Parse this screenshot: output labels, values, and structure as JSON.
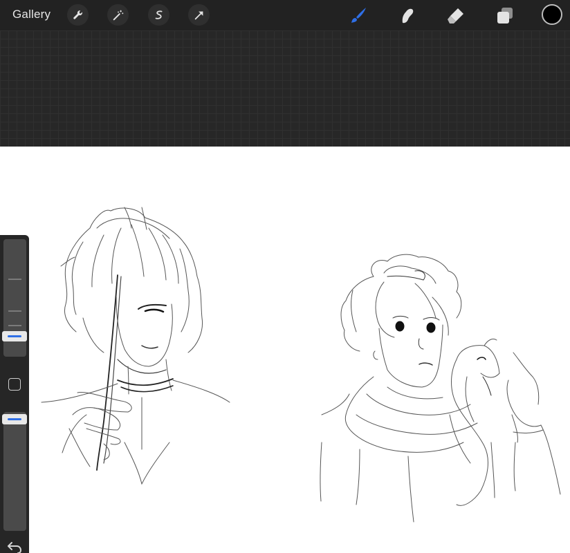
{
  "toolbar": {
    "gallery_label": "Gallery",
    "left_tools": [
      "wrench-icon",
      "magic-wand-icon",
      "selection-icon",
      "transform-arrow-icon"
    ],
    "right_tools": [
      "brush-icon",
      "smudge-icon",
      "eraser-icon",
      "layers-icon"
    ],
    "active_tool": "brush-icon",
    "accent_color": "#2f6fe6",
    "current_color": "#000000"
  },
  "sidebar": {
    "brush_size_level": 0.3,
    "opacity_level": 0.9,
    "controls": [
      "brush-size-slider",
      "modify-button",
      "opacity-slider",
      "undo-icon"
    ]
  },
  "canvas": {
    "background": "#ffffff",
    "content": [
      "sketch-swordsman",
      "sketch-curly-haired-person-with-dragon"
    ]
  }
}
